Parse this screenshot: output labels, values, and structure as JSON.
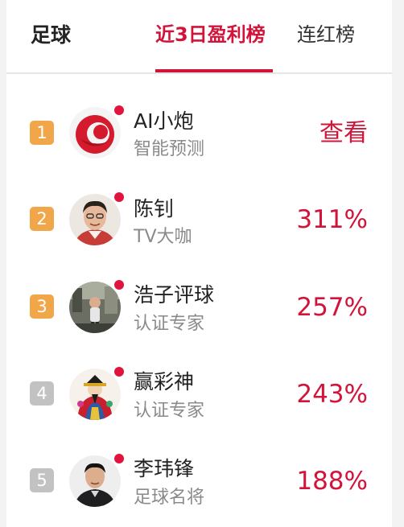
{
  "header": {
    "sport": "足球",
    "tabs": [
      {
        "label": "近3日盈利榜",
        "active": true
      },
      {
        "label": "连红榜",
        "active": false
      }
    ]
  },
  "colors": {
    "accent": "#d2143a",
    "rank_top3": "#f2a64a",
    "rank_other": "#c2c2c2",
    "live_dot": "#e0143c"
  },
  "rows": [
    {
      "rank": "1",
      "name": "AI小炮",
      "title": "智能预测",
      "metric": "查看",
      "avatar": "ai-logo"
    },
    {
      "rank": "2",
      "name": "陈钊",
      "title": "TV大咖",
      "metric": "311%",
      "avatar": "person"
    },
    {
      "rank": "3",
      "name": "浩子评球",
      "title": "认证专家",
      "metric": "257%",
      "avatar": "photo"
    },
    {
      "rank": "4",
      "name": "赢彩神",
      "title": "认证专家",
      "metric": "243%",
      "avatar": "caishen"
    },
    {
      "rank": "5",
      "name": "李玮锋",
      "title": "足球名将",
      "metric": "188%",
      "avatar": "person"
    }
  ]
}
